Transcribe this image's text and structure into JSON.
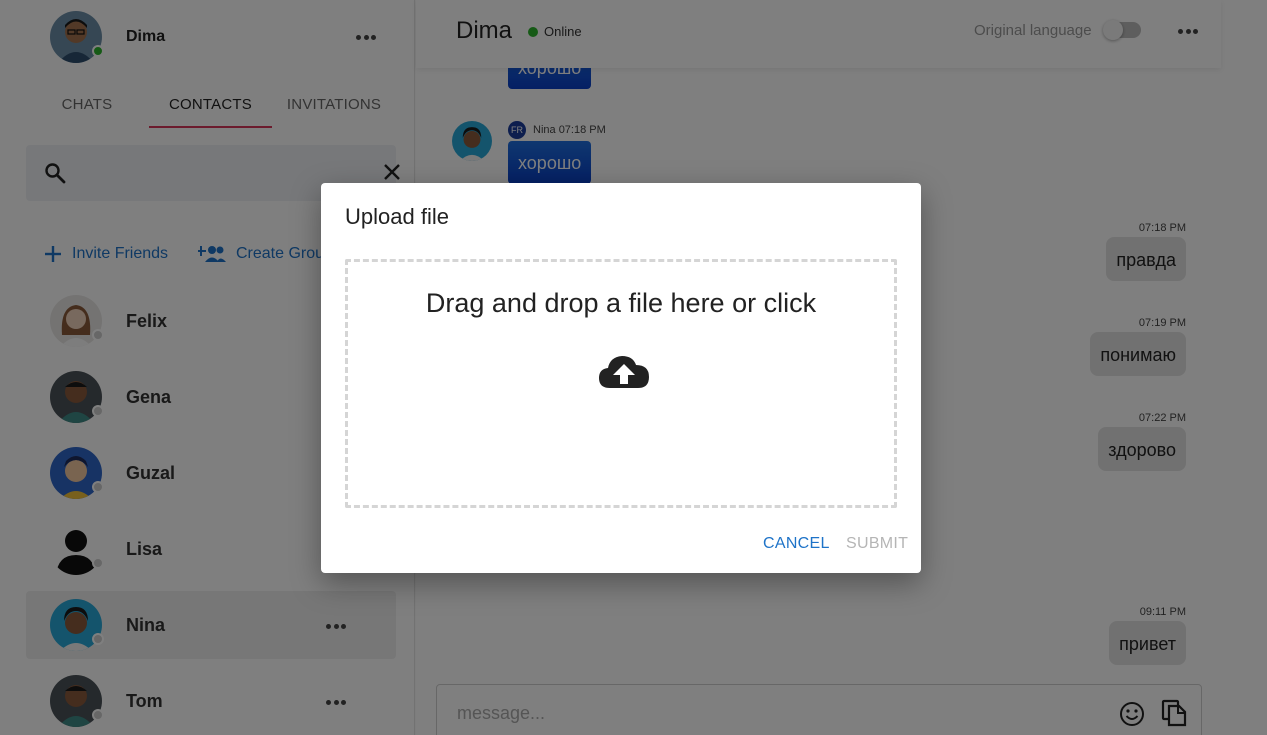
{
  "profile": {
    "name": "Dima"
  },
  "tabs": {
    "chats": "CHATS",
    "contacts": "CONTACTS",
    "invitations": "INVITATIONS"
  },
  "actions": {
    "invite": "Invite Friends",
    "create_group": "Create Group"
  },
  "contacts": [
    {
      "name": "Felix"
    },
    {
      "name": "Gena"
    },
    {
      "name": "Guzal"
    },
    {
      "name": "Lisa"
    },
    {
      "name": "Nina"
    },
    {
      "name": "Tom"
    }
  ],
  "chat": {
    "title": "Dima",
    "status": "Online",
    "language_label": "Original language",
    "messages_in": [
      {
        "text": "хорошо"
      },
      {
        "sender": "Nina",
        "time": "07:18 PM",
        "flag": "FR",
        "text": "хорошо"
      }
    ],
    "messages_out": [
      {
        "time": "07:18 PM",
        "text": "правда"
      },
      {
        "time": "07:19 PM",
        "text": "понимаю"
      },
      {
        "time": "07:22 PM",
        "text": "здорово"
      },
      {
        "time": "09:11 PM",
        "text": "привет"
      }
    ],
    "composer_placeholder": "message..."
  },
  "dialog": {
    "title": "Upload file",
    "dropzone_text": "Drag and drop a file here or click",
    "cancel": "CANCEL",
    "submit": "SUBMIT"
  },
  "colors": {
    "accent": "#1e73c8",
    "tab_indicator": "#d9365a",
    "online": "#2db52d",
    "incoming_bubble": "#0a3fc8"
  },
  "icons": [
    "search-icon",
    "close-icon",
    "plus-icon",
    "group-add-icon",
    "more-icon",
    "emoji-icon",
    "attach-file-icon",
    "cloud-upload-icon"
  ]
}
